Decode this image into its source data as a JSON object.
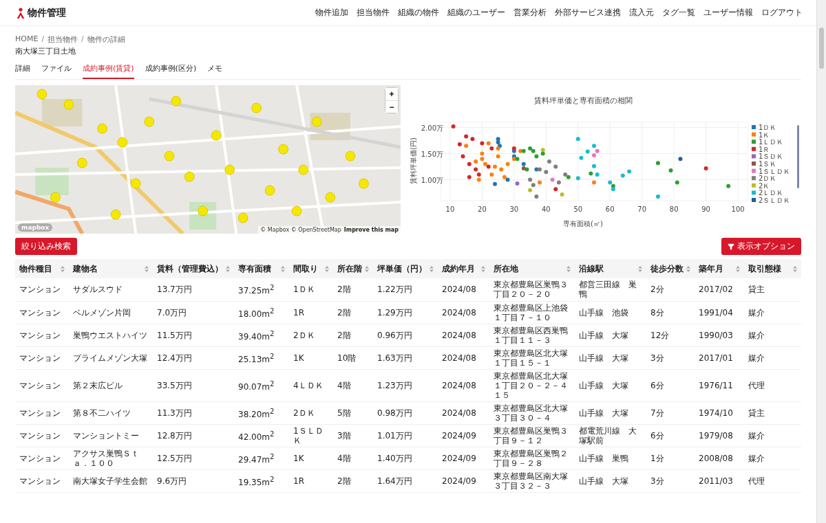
{
  "header": {
    "logo_text": "物件管理",
    "nav": [
      "物件追加",
      "担当物件",
      "組織の物件",
      "組織のユーザー",
      "営業分析",
      "外部サービス連携",
      "流入元",
      "タグ一覧",
      "ユーザー情報",
      "ログアウト"
    ]
  },
  "breadcrumb": {
    "items": [
      "HOME",
      "担当物件",
      "物件の詳細"
    ],
    "separator": "/"
  },
  "page_title": "南大塚三丁目土地",
  "tabs": [
    {
      "label": "詳細",
      "selected": false
    },
    {
      "label": "ファイル",
      "selected": false
    },
    {
      "label": "成約事例(賃貸)",
      "selected": true
    },
    {
      "label": "成約事例(区分)",
      "selected": false
    },
    {
      "label": "メモ",
      "selected": false
    }
  ],
  "map": {
    "kind": "picture",
    "zoom_in": "+",
    "zoom_out": "−",
    "logo": "mapbox",
    "attribution": "© Mapbox © OpenStreetMap",
    "improve_link": "Improve this map"
  },
  "chart": {
    "chart_data": {
      "type": "scatter",
      "title": "賃料坪単価と専有面積の相関",
      "xlabel": "専有面積(㎡)",
      "ylabel": "賃料坪単価(円)",
      "grid": true,
      "xlim": [
        7,
        103
      ],
      "ylim": [
        0.6,
        2.1
      ],
      "legend": true,
      "xticks": [
        10,
        20,
        30,
        40,
        50,
        60,
        70,
        80,
        90,
        100
      ],
      "yticks": [
        {
          "value": 1,
          "label": "1.00万"
        },
        {
          "value": 1.5,
          "label": "1.50万"
        },
        {
          "value": 2,
          "label": "2.00万"
        }
      ],
      "series": [
        {
          "name": "1ＤＫ",
          "color": "#1f77b4",
          "x": [
            25,
            25,
            25.5,
            30,
            30,
            24,
            28,
            33,
            37
          ],
          "values": [
            1.78,
            1.72,
            1.65,
            1.55,
            1.45,
            0.92,
            1.0,
            1.3,
            1.2
          ]
        },
        {
          "name": "1Ｋ",
          "color": "#ff7f0e",
          "x": [
            15,
            18,
            20,
            20,
            21,
            22,
            23,
            25,
            25,
            26,
            27,
            28,
            30,
            32,
            38,
            55,
            24,
            19
          ],
          "values": [
            1.65,
            1.35,
            1.5,
            1.4,
            1.3,
            1.7,
            1.1,
            1.6,
            1.45,
            1.2,
            1.05,
            1.3,
            1.4,
            1.55,
            0.95,
            0.95,
            1.25,
            1.0
          ]
        },
        {
          "name": "1ＬＤＫ",
          "color": "#2ca02c",
          "x": [
            31,
            33,
            35,
            36,
            37,
            39,
            47,
            54,
            61,
            75,
            79,
            81,
            97,
            34
          ],
          "values": [
            1.4,
            1.55,
            1.6,
            1.55,
            1.45,
            1.5,
            1.05,
            1.12,
            0.88,
            1.32,
            1.18,
            0.95,
            0.88,
            1.2
          ]
        },
        {
          "name": "1Ｒ",
          "color": "#d62728",
          "x": [
            11,
            13,
            15,
            16,
            17,
            18,
            19,
            20,
            22,
            23,
            30,
            43,
            90,
            14,
            16
          ],
          "values": [
            2.02,
            1.68,
            1.83,
            1.3,
            1.78,
            1.2,
            1.1,
            1.7,
            1.25,
            1.6,
            1.6,
            0.82,
            1.22,
            1.45,
            1.05
          ]
        },
        {
          "name": "1ＳＤＫ",
          "color": "#9467bd",
          "x": [
            31
          ],
          "values": [
            0.93
          ]
        },
        {
          "name": "1ＳＫ",
          "color": "#8c564b",
          "x": [
            33
          ],
          "values": [
            1.22
          ]
        },
        {
          "name": "1ＳＬＤＫ",
          "color": "#e377c2",
          "x": [
            42,
            55,
            56
          ],
          "values": [
            1.0,
            1.47,
            1.55
          ]
        },
        {
          "name": "2ＤＫ",
          "color": "#7f7f7f",
          "x": [
            35,
            37,
            38,
            40,
            41,
            43,
            44,
            46,
            36
          ],
          "values": [
            1.0,
            0.68,
            1.2,
            1.15,
            1.35,
            1.25,
            0.95,
            1.1,
            0.9
          ]
        },
        {
          "name": "2Ｋ",
          "color": "#bcbd22",
          "x": [
            35,
            39,
            45
          ],
          "values": [
            0.8,
            1.57,
            0.72
          ]
        },
        {
          "name": "2ＬＤＫ",
          "color": "#17becf",
          "x": [
            50,
            50,
            51,
            53,
            55,
            55,
            56,
            60,
            61,
            64,
            66,
            75
          ],
          "values": [
            1.78,
            1.03,
            1.42,
            1.54,
            1.65,
            1.26,
            1.1,
            0.95,
            0.82,
            1.08,
            1.16,
            0.68
          ]
        },
        {
          "name": "2ＳＬＤＫ",
          "color": "#1f5f9e",
          "x": [
            82
          ],
          "values": [
            1.4
          ]
        }
      ]
    }
  },
  "filter_button": "絞り込み検索",
  "options_button": "表示オプション",
  "table": {
    "columns": [
      "物件種目",
      "建物名",
      "賃料（管理費込）",
      "専有面積",
      "間取り",
      "所在階",
      "坪単価（円）",
      "成約年月",
      "所在地",
      "沿線駅",
      "徒歩分数",
      "築年月",
      "取引態様"
    ],
    "rows": [
      [
        "マンション",
        "サダルスウド",
        "13.7万円",
        "37.25m$^{2}$",
        "1ＤＫ",
        "2階",
        "1.22万円",
        "2024/08",
        "東京都豊島区巣鴨３丁目２０－２０",
        "都営三田線　巣鴨",
        "2分",
        "2017/02",
        "貸主"
      ],
      [
        "マンション",
        "ベルメゾン片岡",
        "7.0万円",
        "18.00m$^{2}$",
        "1R",
        "2階",
        "1.29万円",
        "2024/08",
        "東京都豊島区上池袋１丁目７－１０",
        "山手線　池袋",
        "8分",
        "1991/04",
        "媒介"
      ],
      [
        "マンション",
        "巣鴨ウエストハイツ",
        "11.5万円",
        "39.40m$^{2}$",
        "2ＤＫ",
        "2階",
        "0.96万円",
        "2024/08",
        "東京都豊島区西巣鴨１丁目１１－３",
        "山手線　大塚",
        "12分",
        "1990/03",
        "媒介"
      ],
      [
        "マンション",
        "プライムメゾン大塚",
        "12.4万円",
        "25.13m$^{2}$",
        "1K",
        "10階",
        "1.63万円",
        "2024/08",
        "東京都豊島区北大塚１丁目１５－１",
        "山手線　大塚",
        "3分",
        "2017/01",
        "媒介"
      ],
      [
        "マンション",
        "第２末広ビル",
        "33.5万円",
        "90.07m$^{2}$",
        "4ＬＤＫ",
        "4階",
        "1.23万円",
        "2024/08",
        "東京都豊島区北大塚１丁目２０－２－４１５",
        "山手線　大塚",
        "6分",
        "1976/11",
        "代理"
      ],
      [
        "マンション",
        "第８不二ハイツ",
        "11.3万円",
        "38.20m$^{2}$",
        "2ＤＫ",
        "5階",
        "0.98万円",
        "2024/08",
        "東京都豊島区北大塚３丁目３０－４",
        "山手線　大塚",
        "7分",
        "1974/10",
        "貸主"
      ],
      [
        "マンション",
        "マンショントミー",
        "12.8万円",
        "42.00m$^{2}$",
        "1ＳＬＤＫ",
        "3階",
        "1.01万円",
        "2024/09",
        "東京都豊島区巣鴨３丁目９－１２",
        "都電荒川線　大塚駅前",
        "6分",
        "1979/08",
        "媒介"
      ],
      [
        "マンション",
        "アクサス巣鴨Ｓｔａ．１００",
        "12.5万円",
        "29.47m$^{2}$",
        "1K",
        "4階",
        "1.40万円",
        "2024/09",
        "東京都豊島区巣鴨２丁目９－２８",
        "山手線　巣鴨",
        "1分",
        "2008/08",
        "媒介"
      ],
      [
        "マンション",
        "南大塚女子学生会館",
        "9.6万円",
        "19.35m$^{2}$",
        "1R",
        "2階",
        "1.64万円",
        "2024/09",
        "東京都豊島区南大塚３丁目３２－３",
        "山手線　大塚",
        "3分",
        "2011/03",
        "代理"
      ]
    ]
  }
}
